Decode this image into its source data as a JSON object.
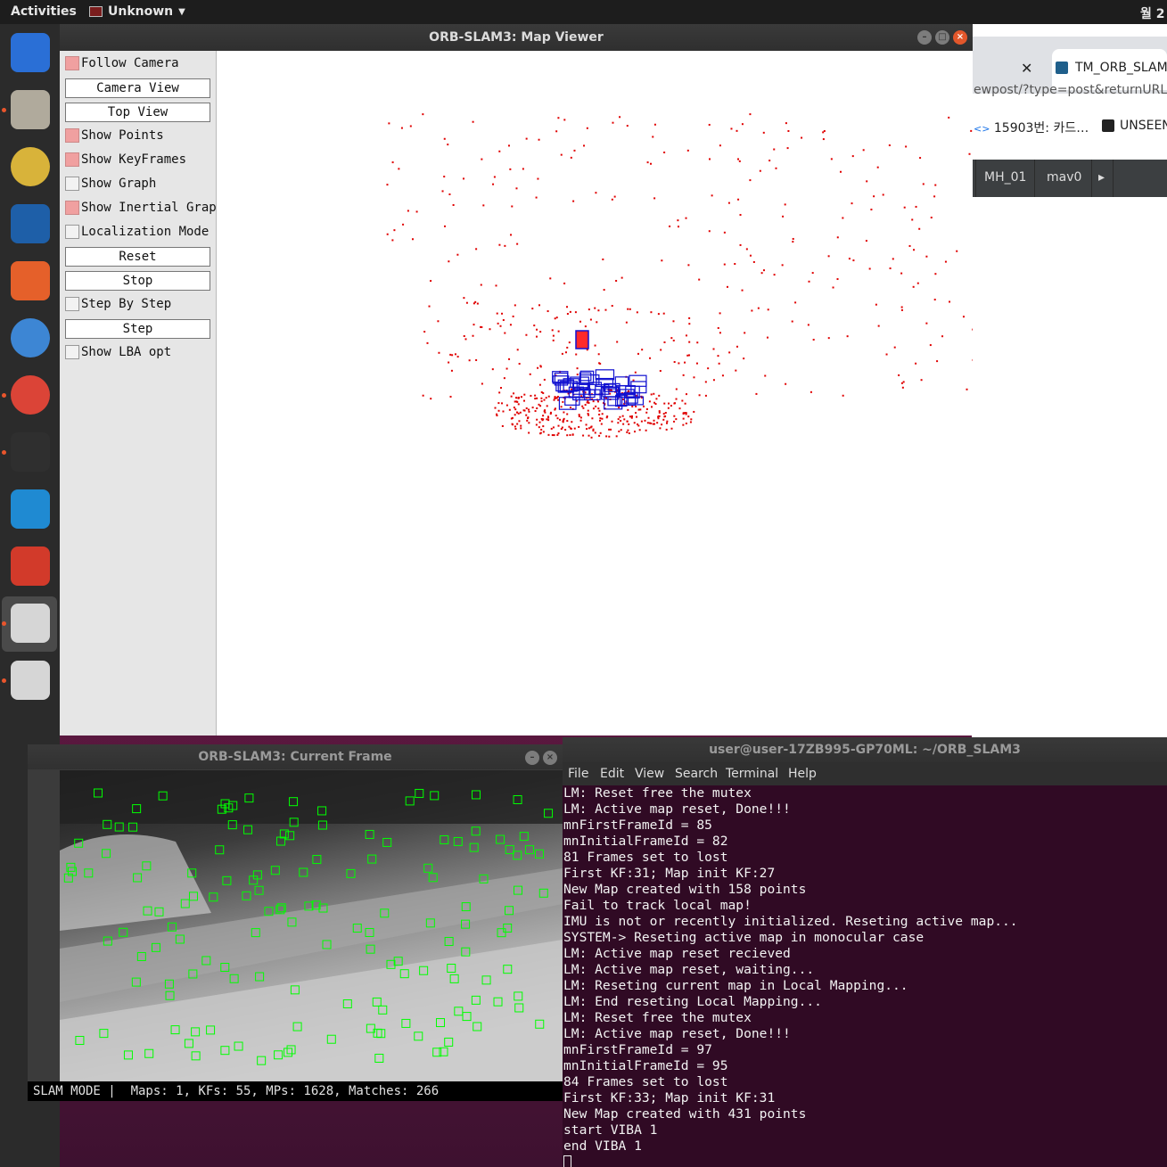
{
  "topbar": {
    "activities": "Activities",
    "app_name": "Unknown",
    "clock": "월 2"
  },
  "dock": {
    "items": [
      {
        "name": "thunderbird",
        "color": "#2a6fd6",
        "running": false
      },
      {
        "name": "files",
        "color": "#b0aa9c",
        "running": true
      },
      {
        "name": "rhythmbox",
        "color": "#d8b33a",
        "running": false
      },
      {
        "name": "writer",
        "color": "#1e5fa8",
        "running": false
      },
      {
        "name": "software",
        "color": "#e5602a",
        "running": false
      },
      {
        "name": "help",
        "color": "#3d86d4",
        "running": false
      },
      {
        "name": "chrome",
        "color": "#db4437",
        "running": true
      },
      {
        "name": "terminal",
        "color": "#2f2f2f",
        "running": true
      },
      {
        "name": "vscode",
        "color": "#1f8ad2",
        "running": false
      },
      {
        "name": "app-tiles",
        "color": "#d23a2a",
        "running": false
      },
      {
        "name": "unknown-app",
        "color": "#d6d6d6",
        "running": true
      },
      {
        "name": "unknown-app",
        "color": "#d6d6d6",
        "running": true
      }
    ]
  },
  "browser": {
    "tab_close": "✕",
    "tab_title": "TM_ORB_SLAM",
    "url": "ewpost/?type=post&returnURL=%",
    "bookmark1": "15903번: 카드…",
    "bookmark2": "UNSEEN",
    "ide_tabs": [
      "MH_01",
      "mav0"
    ],
    "ide_arrow": "▸"
  },
  "mapviewer": {
    "title": "ORB-SLAM3: Map Viewer",
    "controls": [
      {
        "type": "checkbox",
        "label": "Follow Camera",
        "checked": true
      },
      {
        "type": "button",
        "label": "Camera View"
      },
      {
        "type": "button",
        "label": "Top View"
      },
      {
        "type": "checkbox",
        "label": "Show Points",
        "checked": true
      },
      {
        "type": "checkbox",
        "label": "Show KeyFrames",
        "checked": true
      },
      {
        "type": "checkbox",
        "label": "Show Graph",
        "checked": false
      },
      {
        "type": "checkbox",
        "label": "Show Inertial Graph",
        "checked": true
      },
      {
        "type": "checkbox",
        "label": "Localization Mode",
        "checked": false
      },
      {
        "type": "button",
        "label": "Reset"
      },
      {
        "type": "button",
        "label": "Stop"
      },
      {
        "type": "checkbox",
        "label": "Step By Step",
        "checked": false
      },
      {
        "type": "button",
        "label": "Step"
      },
      {
        "type": "checkbox",
        "label": "Show LBA opt",
        "checked": false
      }
    ],
    "colors": {
      "map_point": "#e00000",
      "keyframe": "#1010d0",
      "current_camera": "#ff2a2a"
    }
  },
  "currentframe": {
    "title": "ORB-SLAM3: Current Frame",
    "status": "SLAM MODE |  Maps: 1, KFs: 55, MPs: 1628, Matches: 266",
    "feature_color": "#00ff00"
  },
  "terminal": {
    "title": "user@user-17ZB995-GP70ML: ~/ORB_SLAM3",
    "menu": [
      "File",
      "Edit",
      "View",
      "Search",
      "Terminal",
      "Help"
    ],
    "lines": [
      "LM: Reset free the mutex",
      "LM: Active map reset, Done!!!",
      "mnFirstFrameId = 85",
      "mnInitialFrameId = 82",
      "81 Frames set to lost",
      "First KF:31; Map init KF:27",
      "New Map created with 158 points",
      "Fail to track local map!",
      "IMU is not or recently initialized. Reseting active map...",
      "SYSTEM-> Reseting active map in monocular case",
      "LM: Active map reset recieved",
      "LM: Active map reset, waiting...",
      "LM: Reseting current map in Local Mapping...",
      "LM: End reseting Local Mapping...",
      "LM: Reset free the mutex",
      "LM: Active map reset, Done!!!",
      "mnFirstFrameId = 97",
      "mnInitialFrameId = 95",
      "84 Frames set to lost",
      "First KF:33; Map init KF:31",
      "New Map created with 431 points",
      "start VIBA 1",
      "end VIBA 1"
    ]
  }
}
